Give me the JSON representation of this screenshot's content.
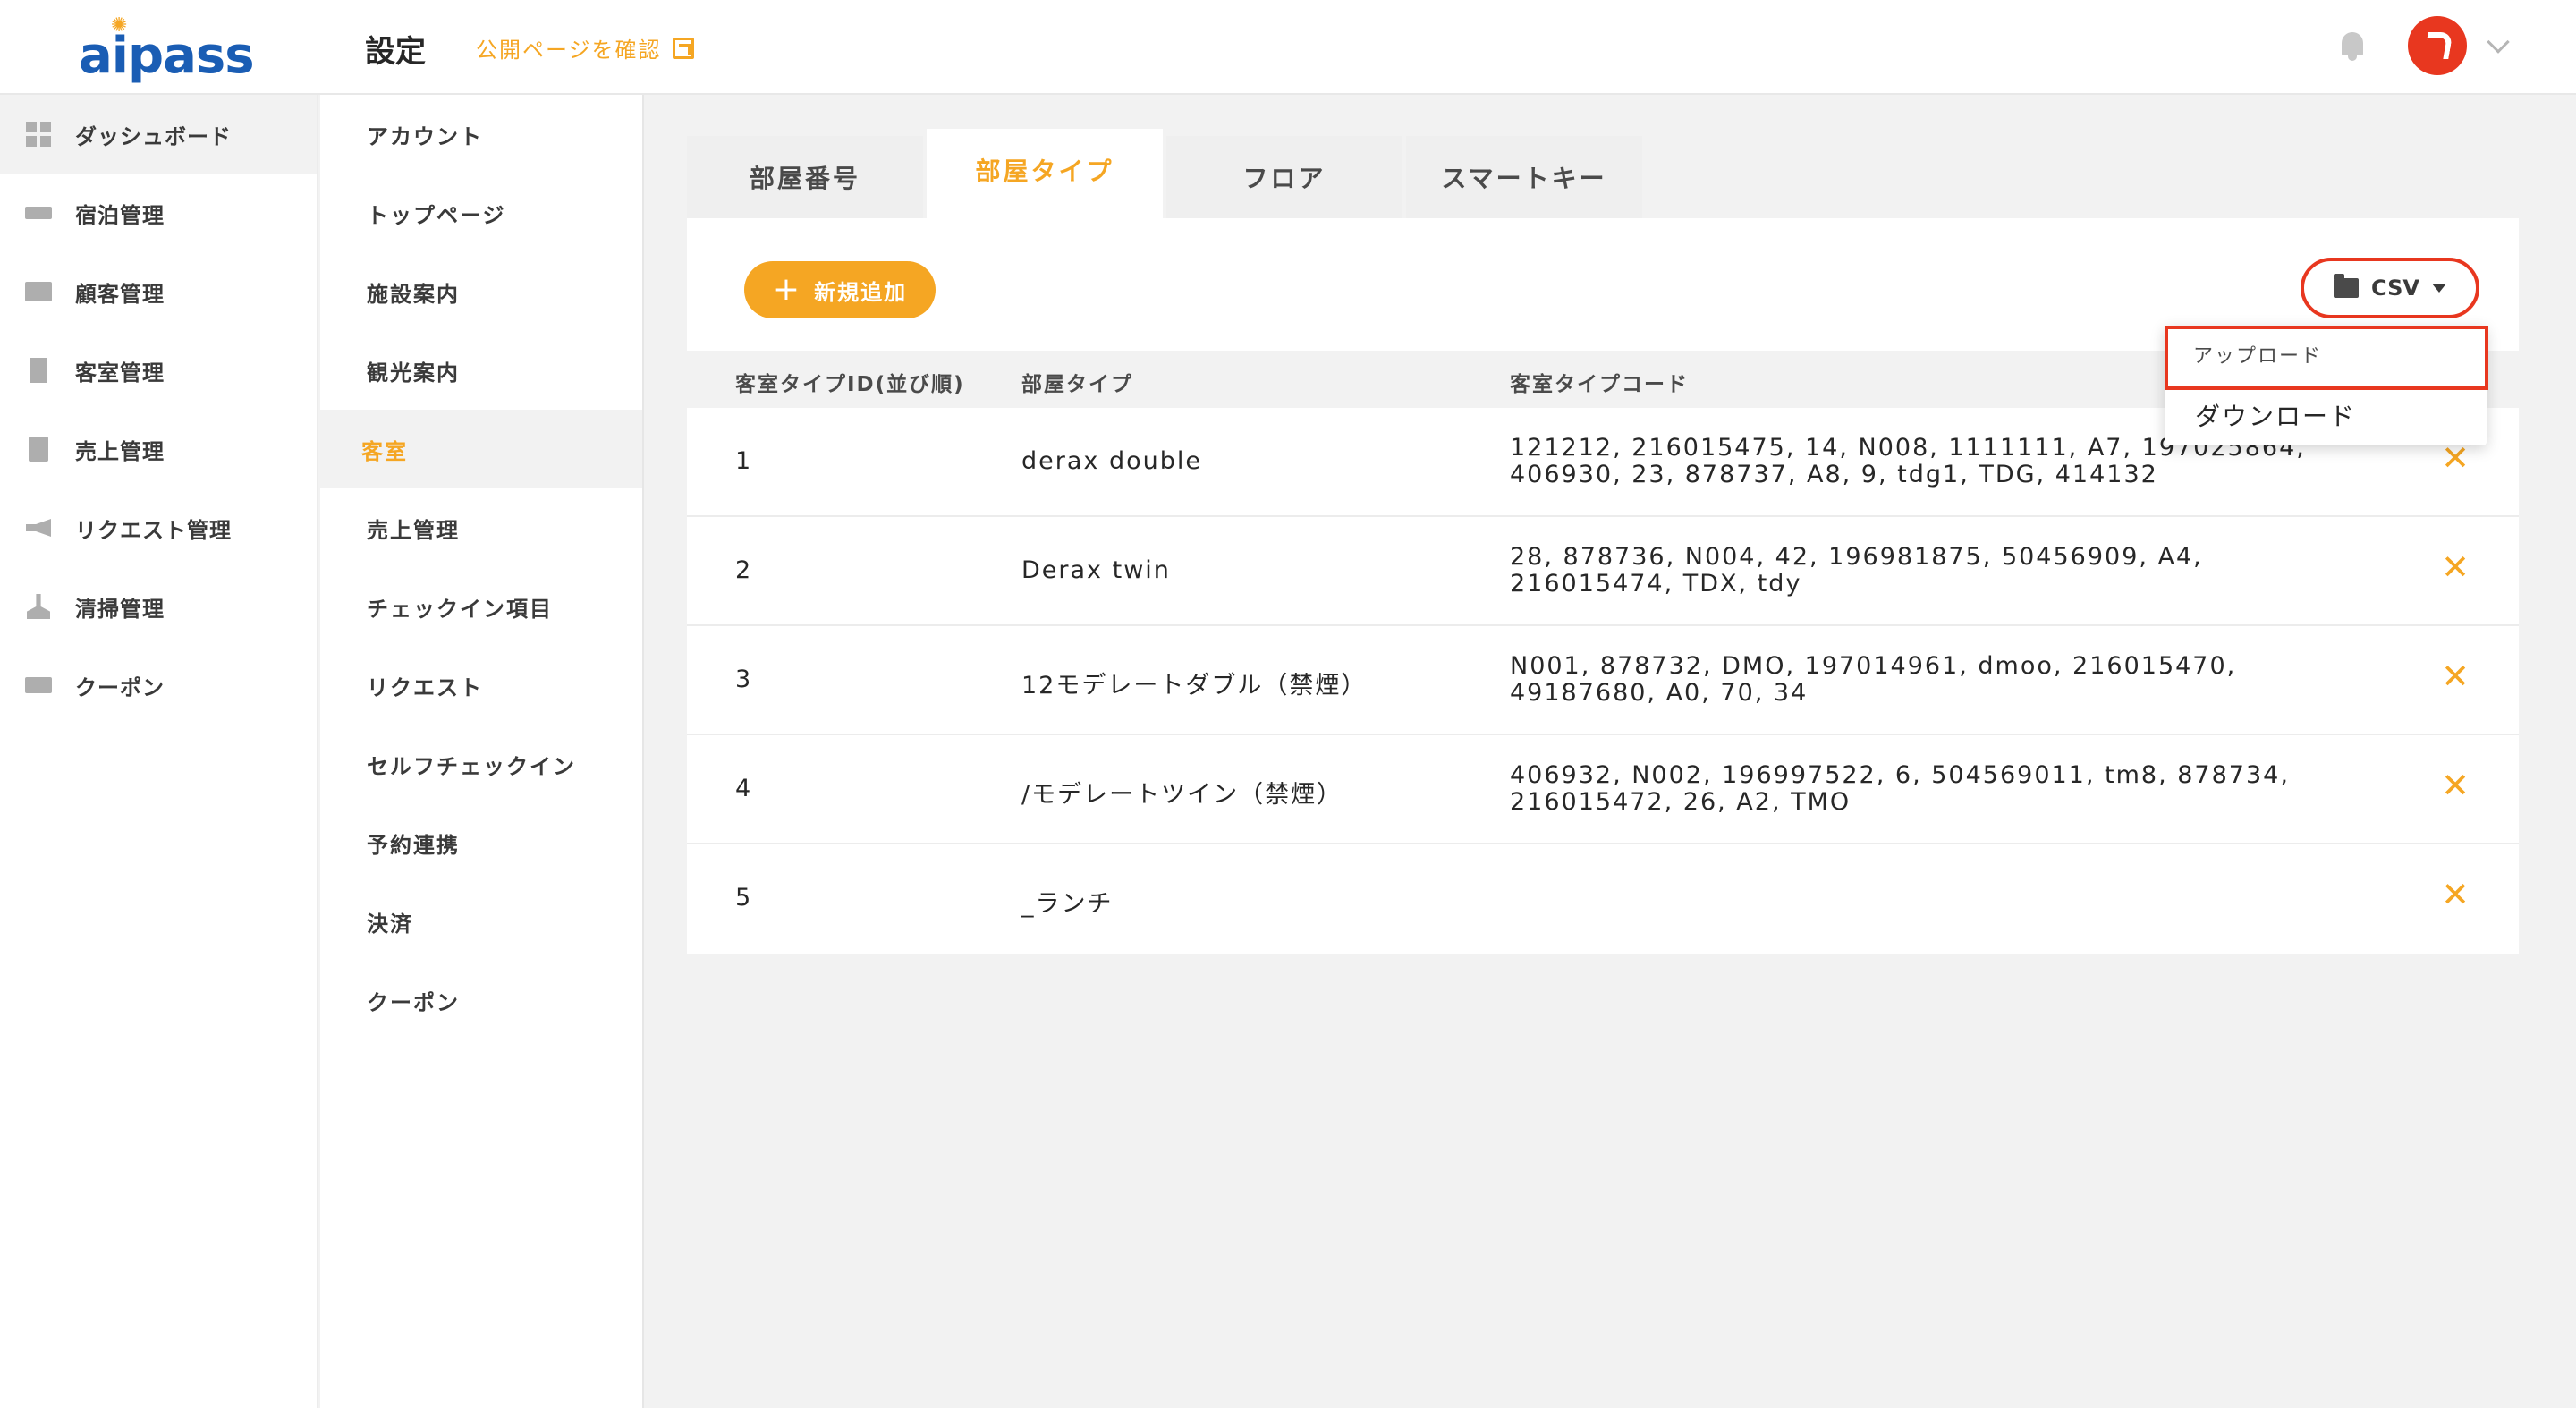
{
  "app": {
    "logo_text": "aipass"
  },
  "header": {
    "title": "設定",
    "public_link": "公開ページを確認"
  },
  "sidebar": {
    "items": [
      {
        "label": "ダッシュボード",
        "icon": "dashboard-icon"
      },
      {
        "label": "宿泊管理",
        "icon": "bed-icon"
      },
      {
        "label": "顧客管理",
        "icon": "folder-person-icon"
      },
      {
        "label": "客室管理",
        "icon": "door-icon"
      },
      {
        "label": "売上管理",
        "icon": "calculator-icon"
      },
      {
        "label": "リクエスト管理",
        "icon": "megaphone-icon"
      },
      {
        "label": "清掃管理",
        "icon": "broom-icon"
      },
      {
        "label": "クーポン",
        "icon": "ticket-icon"
      }
    ]
  },
  "subnav": {
    "items": [
      {
        "label": "アカウント"
      },
      {
        "label": "トップページ"
      },
      {
        "label": "施設案内"
      },
      {
        "label": "観光案内"
      },
      {
        "label": "客室"
      },
      {
        "label": "売上管理"
      },
      {
        "label": "チェックイン項目"
      },
      {
        "label": "リクエスト"
      },
      {
        "label": "セルフチェックイン"
      },
      {
        "label": "予約連携"
      },
      {
        "label": "決済"
      },
      {
        "label": "クーポン"
      }
    ]
  },
  "tabs": [
    {
      "label": "部屋番号"
    },
    {
      "label": "部屋タイプ"
    },
    {
      "label": "フロア"
    },
    {
      "label": "スマートキー"
    }
  ],
  "toolbar": {
    "add_label": "新規追加",
    "csv_label": "CSV"
  },
  "csv_menu": {
    "upload": "アップロード",
    "download": "ダウンロード"
  },
  "table": {
    "headers": [
      "客室タイプID(並び順)",
      "部屋タイプ",
      "客室タイプコード"
    ],
    "rows": [
      {
        "id": "1",
        "type": "derax double",
        "codes": "121212, 216015475, 14, N008, 1111111, A7, 197025864, 406930, 23, 878737, A8, 9, tdg1, TDG, 414132"
      },
      {
        "id": "2",
        "type": "Derax twin",
        "codes": "28, 878736, N004, 42, 196981875, 50456909, A4, 216015474, TDX, tdy"
      },
      {
        "id": "3",
        "type": "12モデレートダブル（禁煙）",
        "codes": "N001, 878732, DMO, 197014961, dmoo, 216015470, 49187680, A0, 70, 34"
      },
      {
        "id": "4",
        "type": "/モデレートツイン（禁煙）",
        "codes": "406932, N002, 196997522, 6, 504569011, tm8, 878734, 216015472, 26, A2, TMO"
      },
      {
        "id": "5",
        "type": "_ランチ",
        "codes": ""
      }
    ]
  },
  "colors": {
    "accent": "#f5a623",
    "brand": "#1a5db4",
    "highlight": "#e8371f"
  }
}
